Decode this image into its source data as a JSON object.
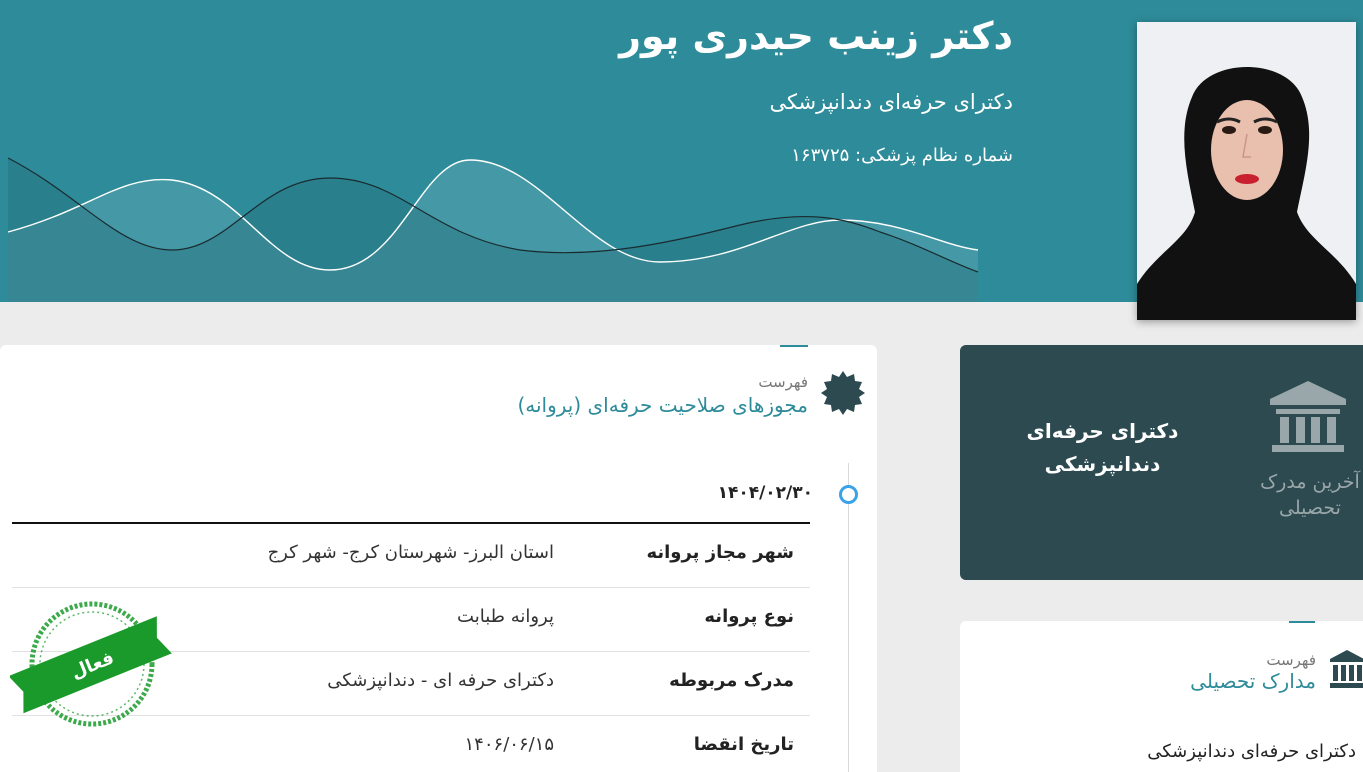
{
  "header": {
    "name": "دکتر زینب حیدری پور",
    "degree": "دکترای حرفه‌ای دندانپزشکی",
    "license_label": "شماره نظام پزشکی:",
    "license_number": "۱۶۳۷۲۵"
  },
  "last_degree": {
    "caption": "آخرین مدرک تحصیلی",
    "title": "دکترای حرفه‌ای دندانپزشکی"
  },
  "education": {
    "kicker": "فهرست",
    "title": "مدارک تحصیلی",
    "items": [
      "دکترای حرفه‌ای دندانپزشکی"
    ]
  },
  "licenses": {
    "kicker": "فهرست",
    "title": "مجوزهای صلاحیت حرفه‌ای (پروانه)",
    "entries": [
      {
        "date": "۱۴۰۴/۰۲/۳۰",
        "rows": [
          {
            "label": "شهر مجاز پروانه",
            "value": "استان البرز- شهرستان کرج- شهر کرج"
          },
          {
            "label": "نوع پروانه",
            "value": "پروانه طبابت"
          },
          {
            "label": "مدرک مربوطه",
            "value": "دکترای حرفه ای - دندانپزشکی"
          },
          {
            "label": "تاریخ انقضا",
            "value": "۱۴۰۶/۰۶/۱۵"
          }
        ],
        "status": "فعال"
      }
    ]
  },
  "colors": {
    "banner": "#2e8b99",
    "tile": "#2c4a50",
    "accent": "#2e8b99",
    "stamp": "#1a9a2a",
    "timeline_dot": "#3aa3e8"
  }
}
